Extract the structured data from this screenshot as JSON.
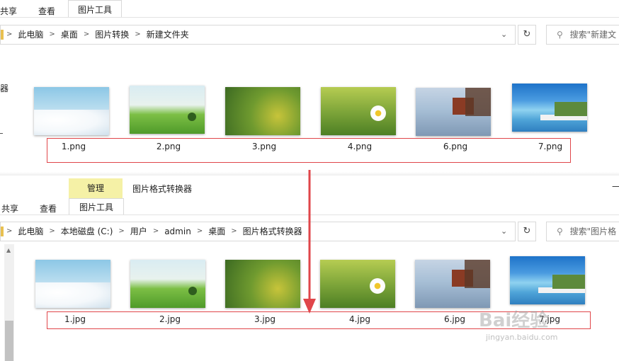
{
  "top": {
    "ribbon": {
      "share": "共享",
      "view": "查看",
      "picture_tools": "图片工具"
    },
    "breadcrumb": [
      "此电脑",
      "桌面",
      "图片转换",
      "新建文件夹"
    ],
    "search_placeholder": "搜索\"新建文",
    "left_fragment": "器",
    "files": [
      "1.png",
      "2.png",
      "3.png",
      "4.png",
      "6.png",
      "7.png"
    ]
  },
  "bottom": {
    "context_tab": "管理",
    "window_title": "图片格式转换器",
    "ribbon": {
      "share": "共享",
      "view": "查看",
      "picture_tools": "图片工具"
    },
    "breadcrumb": [
      "此电脑",
      "本地磁盘 (C:)",
      "用户",
      "admin",
      "桌面",
      "图片格式转换器"
    ],
    "search_placeholder": "搜索\"图片格",
    "minimize": "—",
    "files": [
      "1.jpg",
      "2.jpg",
      "3.jpg",
      "4.jpg",
      "6.jpg",
      "7.jpg"
    ]
  },
  "watermark": {
    "brand": "Bai经验",
    "url": "jingyan.baidu.com"
  },
  "colors": {
    "red_highlight": "#e0464a",
    "context_yellow": "#f5f1a6"
  },
  "icons": {
    "back_chevron": "chevron-right-icon",
    "refresh": "refresh-icon",
    "search": "search-icon"
  }
}
